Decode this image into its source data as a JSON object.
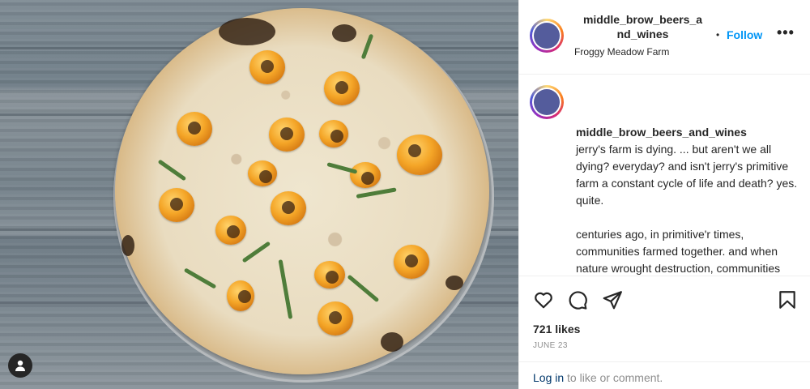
{
  "header": {
    "username_line1": "middle_brow_beers_a",
    "username_line2": "nd_wines",
    "separator": "•",
    "follow_label": "Follow",
    "more_label": "•••",
    "location": "Froggy Meadow Farm"
  },
  "caption": {
    "username": "middle_brow_beers_and_wines",
    "text": "jerry's farm is dying. ... but aren't we all dying? everyday? and isn't jerry's primitive farm a constant cycle of life and death? yes. quite.\n\ncenturies ago, in primitive'r times, communities farmed together. and when nature wrought destruction, communities rebuilt together. and farmed again together. for themselves and each other."
  },
  "actions": {
    "like_icon": "heart-icon",
    "comment_icon": "comment-icon",
    "share_icon": "paper-plane-icon",
    "save_icon": "bookmark-icon"
  },
  "likes": "721 likes",
  "date": "JUNE 23",
  "footer": {
    "login_label": "Log in",
    "rest": " to like or comment."
  },
  "colors": {
    "accent": "#0095f6",
    "text": "#262626",
    "muted": "#8e8e8e",
    "link": "#00376b",
    "avatar_fill": "#545c9c"
  },
  "media": {
    "alt": "pizza with yellow cherry tomatoes on a wooden table"
  }
}
